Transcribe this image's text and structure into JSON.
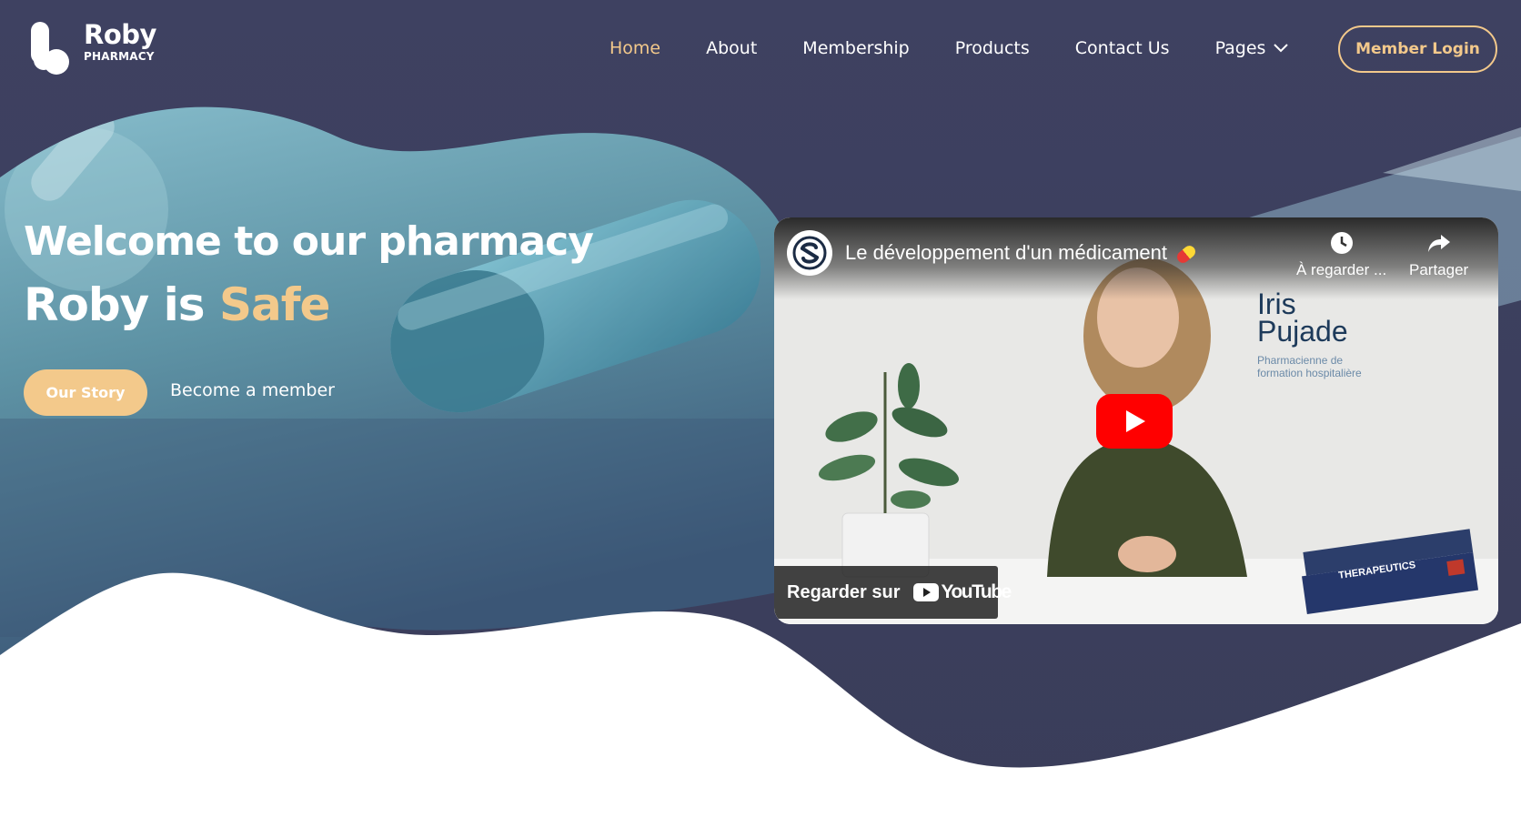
{
  "brand": {
    "name": "Roby",
    "tagline": "PHARMACY"
  },
  "nav": {
    "items": [
      {
        "label": "Home",
        "active": true
      },
      {
        "label": "About",
        "active": false
      },
      {
        "label": "Membership",
        "active": false
      },
      {
        "label": "Products",
        "active": false
      },
      {
        "label": "Contact Us",
        "active": false
      },
      {
        "label": "Pages",
        "active": false,
        "icon": "chevron-down-icon"
      }
    ],
    "login_label": "Member Login"
  },
  "hero": {
    "title": "Welcome to our pharmacy",
    "subtitle_prefix": "Roby is ",
    "subtitle_accent": "Safe",
    "primary_button": "Our Story",
    "secondary_link": "Become a member"
  },
  "video": {
    "title": "Le développement d'un médicament",
    "watch_later_label": "À regarder ...",
    "share_label": "Partager",
    "person_first_name": "Iris",
    "person_last_name": "Pujade",
    "person_role_line1": "Pharmacienne de",
    "person_role_line2": "formation hospitalière",
    "book_label": "THERAPEUTICS",
    "watch_on_label": "Regarder sur",
    "youtube_label": "YouTube"
  },
  "colors": {
    "navy": "#3c3f5d",
    "accent": "#f3c98b",
    "teal": "#5e93a5",
    "white": "#ffffff",
    "youtube_red": "#ff0000"
  }
}
